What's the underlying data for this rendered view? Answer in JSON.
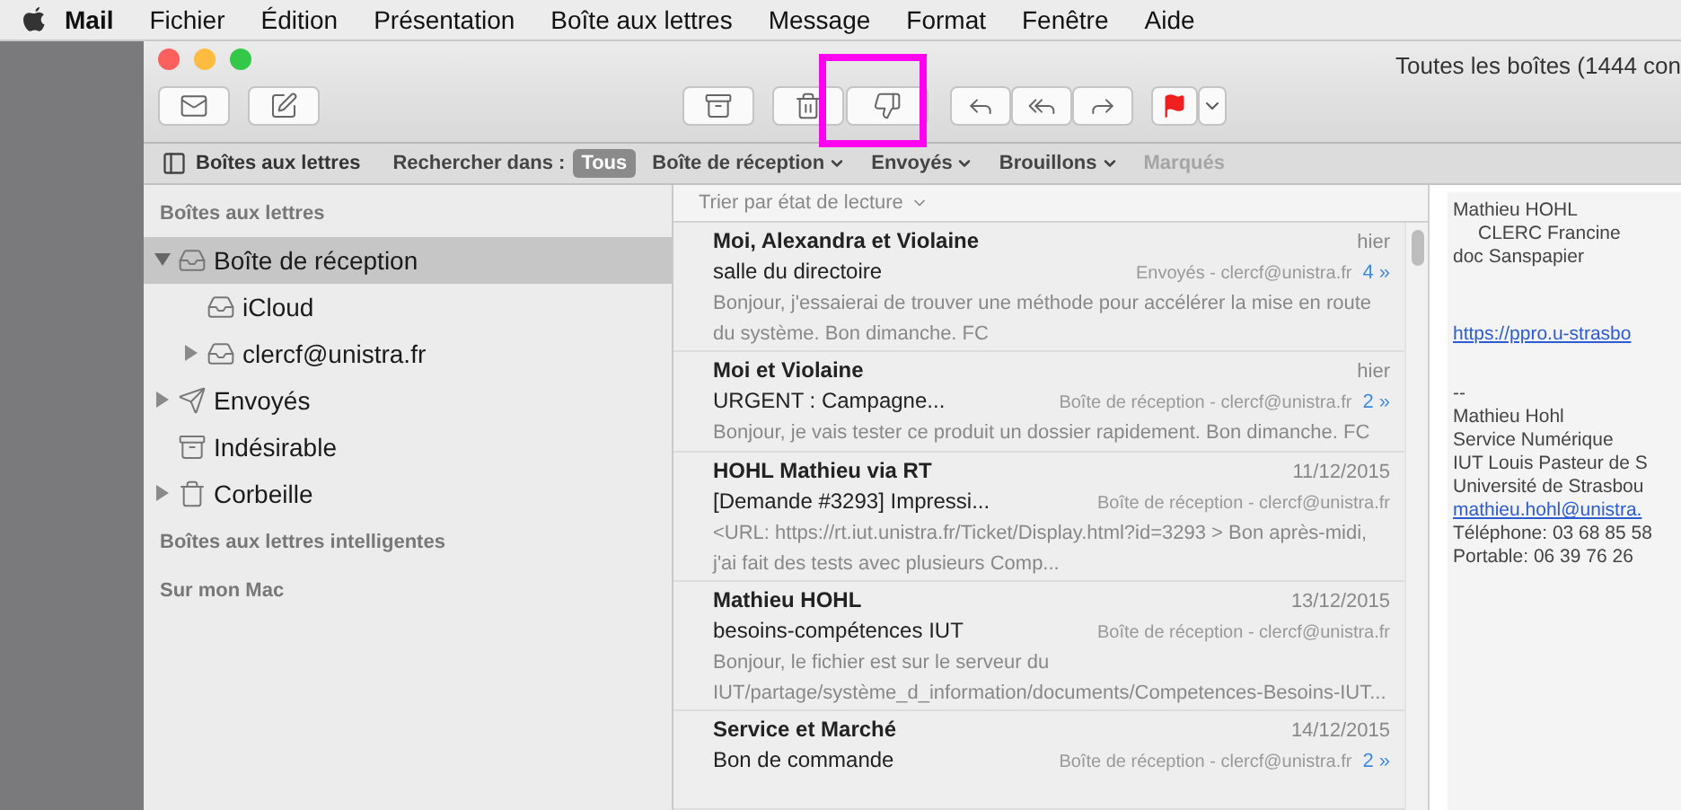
{
  "menu_bar": {
    "app": "Mail",
    "items": [
      "Fichier",
      "Édition",
      "Présentation",
      "Boîte aux lettres",
      "Message",
      "Format",
      "Fenêtre",
      "Aide"
    ]
  },
  "window": {
    "title": "Toutes les boîtes (1444 con",
    "junk_button_highlighted": true
  },
  "filter_bar": {
    "mailboxes_button": "Boîtes aux lettres",
    "search_label": "Rechercher dans :",
    "scopes": [
      {
        "label": "Tous",
        "selected": true,
        "dropdown": false,
        "disabled": false
      },
      {
        "label": "Boîte de réception",
        "selected": false,
        "dropdown": true,
        "disabled": false
      },
      {
        "label": "Envoyés",
        "selected": false,
        "dropdown": true,
        "disabled": false
      },
      {
        "label": "Brouillons",
        "selected": false,
        "dropdown": true,
        "disabled": false
      },
      {
        "label": "Marqués",
        "selected": false,
        "dropdown": false,
        "disabled": true
      }
    ]
  },
  "sidebar": {
    "sections": [
      {
        "heading": "Boîtes aux lettres",
        "items": [
          {
            "label": "Boîte de réception",
            "kind": "inbox",
            "expanded": true,
            "selected": true,
            "children": [
              {
                "label": "iCloud",
                "kind": "inbox",
                "selected": false
              },
              {
                "label": "clercf@unistra.fr",
                "kind": "inbox",
                "expanded": false,
                "selected": false
              }
            ]
          },
          {
            "label": "Envoyés",
            "kind": "sent",
            "expanded": false,
            "selected": false
          },
          {
            "label": "Indésirable",
            "kind": "junk",
            "selected": false
          },
          {
            "label": "Corbeille",
            "kind": "trash",
            "expanded": false,
            "selected": false
          }
        ]
      },
      {
        "heading": "Boîtes aux lettres intelligentes"
      },
      {
        "heading": "Sur mon Mac"
      }
    ]
  },
  "message_list": {
    "sort_label": "Trier par état de lecture",
    "messages": [
      {
        "sender": "Moi, Alexandra et Violaine",
        "date": "hier",
        "subject": "salle du directoire",
        "mailbox": "Envoyés - clercf@unistra.fr",
        "count": "4 »",
        "preview": "Bonjour, j'essaierai de trouver une méthode pour accélérer la mise en route du système. Bon dimanche. FC"
      },
      {
        "sender": "Moi et Violaine",
        "date": "hier",
        "subject": "URGENT : Campagne...",
        "mailbox": "Boîte de réception - clercf@unistra.fr",
        "count": "2 »",
        "preview": "Bonjour, je vais tester ce produit un dossier rapidement. Bon dimanche. FC"
      },
      {
        "sender": "HOHL Mathieu via RT",
        "date": "11/12/2015",
        "subject": "[Demande #3293] Impressi...",
        "mailbox": "Boîte de réception - clercf@unistra.fr",
        "preview": "<URL: https://rt.iut.unistra.fr/Ticket/Display.html?id=3293 > Bon après-midi, j'ai fait des tests avec plusieurs Comp..."
      },
      {
        "sender": "Mathieu HOHL",
        "date": "13/12/2015",
        "subject": "besoins-compétences IUT",
        "mailbox": "Boîte de réception - clercf@unistra.fr",
        "preview": "Bonjour, le fichier est sur le serveur du IUT/partage/système_d_information/documents/Competences-Besoins-IUT..."
      },
      {
        "sender": "Service et Marché",
        "date": "14/12/2015",
        "subject": "Bon de commande",
        "mailbox": "Boîte de réception - clercf@unistra.fr",
        "count": "2 »"
      }
    ]
  },
  "preview_pane": {
    "sender": "Mathieu HOHL",
    "to": "CLERC Francine",
    "subject": "doc Sanspapier",
    "link": "https://ppro.u-strasbo",
    "signature": [
      "--",
      "Mathieu Hohl",
      "Service Numérique",
      "IUT Louis Pasteur de S",
      "Université de Strasbou"
    ],
    "email_link": "mathieu.hohl@unistra.",
    "phones": [
      "Téléphone: 03 68 85 58",
      "Portable: 06 39 76 26"
    ]
  }
}
